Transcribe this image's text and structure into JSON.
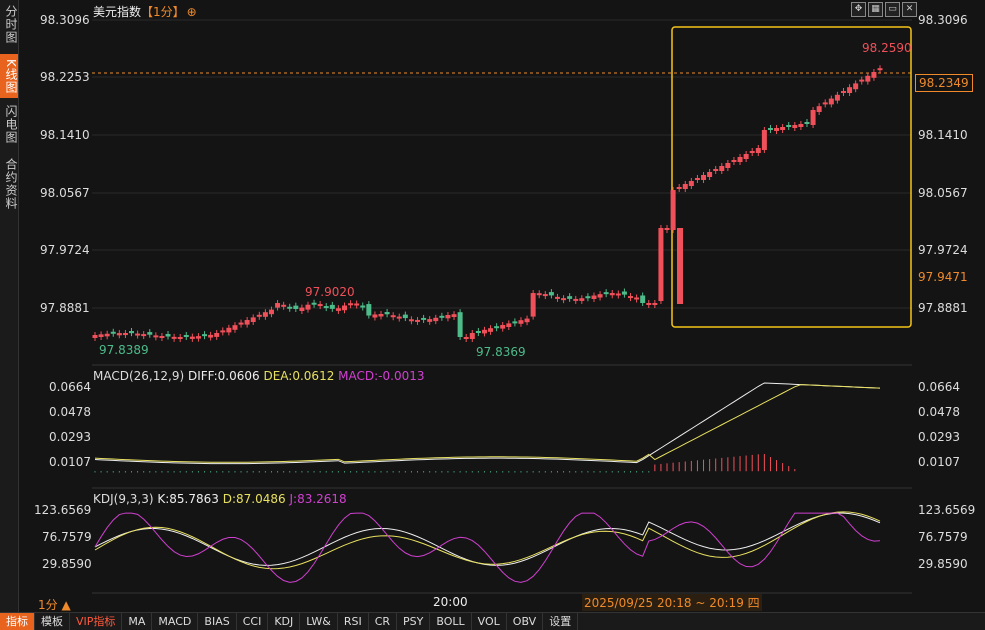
{
  "sidebar": {
    "tabs": [
      {
        "label": "分时图",
        "active": false
      },
      {
        "label": "K线图",
        "active": true
      },
      {
        "label": "闪电图",
        "active": false
      },
      {
        "label": "合约资料",
        "active": false
      }
    ]
  },
  "header": {
    "name": "美元指数",
    "period": "【1分】",
    "target_icon": "⊕"
  },
  "toolbar": {
    "icons": [
      "expand-icon",
      "grid-icon",
      "window-icon",
      "close-icon"
    ]
  },
  "price_axis": [
    "98.3096",
    "98.2253",
    "98.1410",
    "98.0567",
    "97.9724",
    "97.8881"
  ],
  "price_tags": {
    "current": "98.2349",
    "cursor": "97.9471"
  },
  "annotations": {
    "high_left": "97.9020",
    "low_left": "97.8389",
    "low_mid": "97.8369",
    "high_right": "98.2590"
  },
  "macd": {
    "label": "MACD(26,12,9)",
    "diff": "DIFF:0.0606",
    "dea": "DEA:0.0612",
    "macd": "MACD:-0.0013",
    "axis": [
      "0.0664",
      "0.0478",
      "0.0293",
      "0.0107"
    ]
  },
  "kdj": {
    "label": "KDJ(9,3,3)",
    "k": "K:85.7863",
    "d": "D:87.0486",
    "j": "J:83.2618",
    "axis": [
      "123.6569",
      "76.7579",
      "29.8590"
    ]
  },
  "time_axis": {
    "period": "1分 ▲",
    "tick": "20:00",
    "cursor": "2025/09/25 20:18 ~ 20:19 四"
  },
  "bottom_tabs": [
    "指标",
    "模板",
    "VIP指标",
    "MA",
    "MACD",
    "BIAS",
    "CCI",
    "KDJ",
    "LW&",
    "RSI",
    "CR",
    "PSY",
    "BOLL",
    "VOL",
    "OBV",
    "设置"
  ],
  "colors": {
    "up": "#f0505a",
    "down": "#4dbb8a",
    "highlight_box": "#f5c518",
    "accent": "#e8631e",
    "dea": "#e8e060",
    "macd_val": "#d040d0"
  }
}
